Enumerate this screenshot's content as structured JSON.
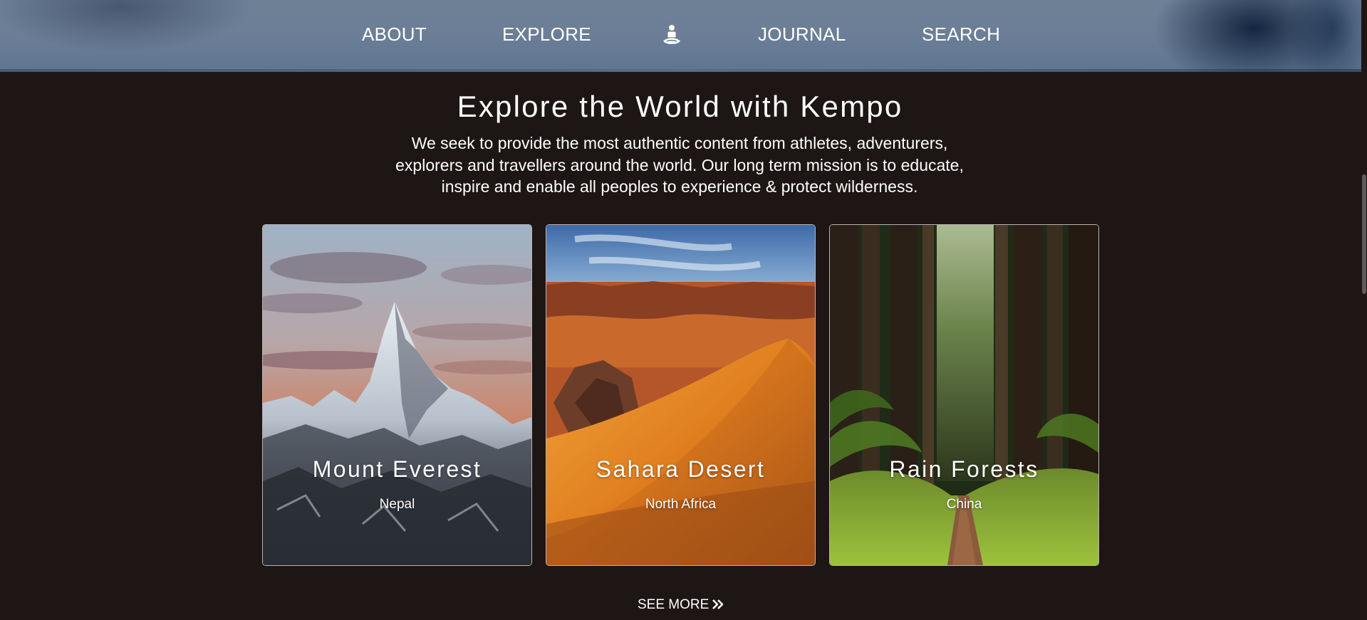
{
  "nav": {
    "items": [
      {
        "label": "ABOUT"
      },
      {
        "label": "EXPLORE"
      },
      {
        "label": "JOURNAL"
      },
      {
        "label": "SEARCH"
      }
    ],
    "logo_icon": "meditation-figure-icon"
  },
  "hero": {
    "title": "Explore the World with Kempo",
    "description": "We seek to provide the most authentic content from athletes, adventurers, explorers and travellers around the world. Our long term mission is to educate, inspire and enable all peoples to experience & protect wilderness."
  },
  "cards": [
    {
      "title": "Mount Everest",
      "subtitle": "Nepal"
    },
    {
      "title": "Sahara Desert",
      "subtitle": "North Africa"
    },
    {
      "title": "Rain Forests",
      "subtitle": "China"
    }
  ],
  "see_more": {
    "label": "SEE MORE",
    "icon": "double-chevron-right-icon"
  },
  "colors": {
    "background": "#1e1515",
    "nav_banner": "#6c7f97",
    "text": "#ffffff",
    "card_border": "#b9b3b0"
  }
}
